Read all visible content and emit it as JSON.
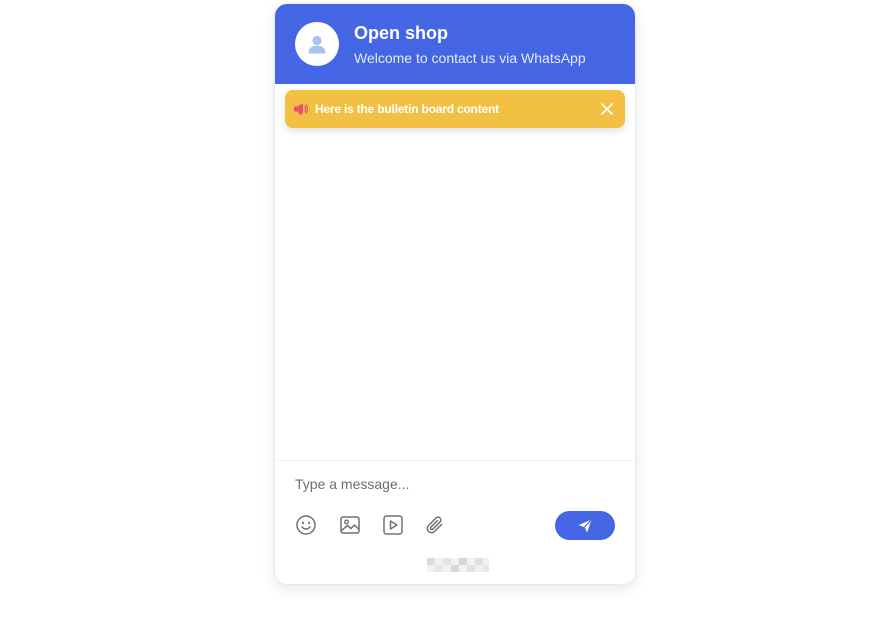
{
  "header": {
    "avatar_icon": "user-avatar-icon",
    "title": "Open shop",
    "subtitle": "Welcome to contact us via WhatsApp",
    "background_color": "#4466e4"
  },
  "bulletin": {
    "icon": "megaphone-icon",
    "text": "Here is the bulletin board content",
    "close_icon": "close-icon",
    "background_color": "#f2c143"
  },
  "composer": {
    "placeholder": "Type a message...",
    "tools": [
      "emoji-icon",
      "image-icon",
      "video-icon",
      "attachment-icon"
    ],
    "send_icon": "send-icon"
  },
  "footer": {
    "branding": "pixelated-branding-logo"
  }
}
